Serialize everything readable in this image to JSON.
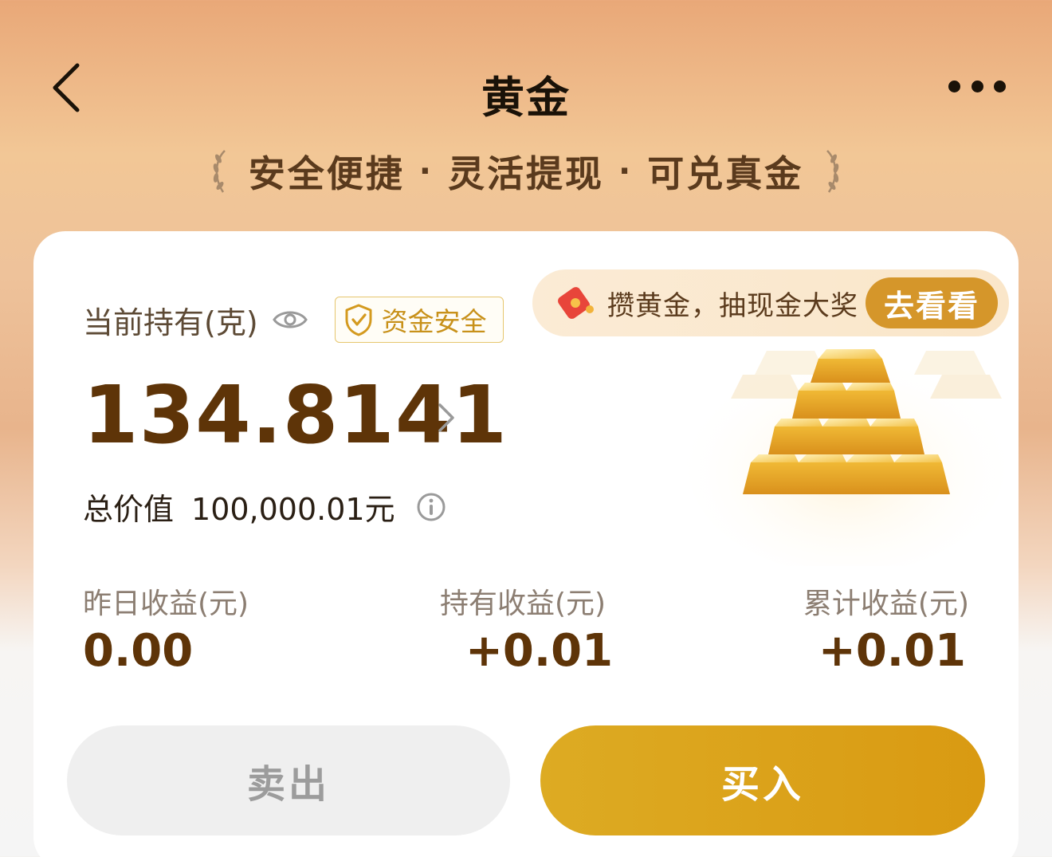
{
  "header": {
    "title": "黄金"
  },
  "slogan": {
    "items": [
      "安全便捷",
      "灵活提现",
      "可兑真金"
    ],
    "separator": "·"
  },
  "holding": {
    "label": "当前持有(克)",
    "safety_badge": "资金安全",
    "grams": "134.8141",
    "total_label": "总价值",
    "total_value": "100,000.01元"
  },
  "promo": {
    "text": "攒黄金，抽现金大奖",
    "button": "去看看"
  },
  "stats": [
    {
      "label": "昨日收益(元)",
      "value": "0.00"
    },
    {
      "label": "持有收益(元)",
      "value": "+0.01"
    },
    {
      "label": "累计收益(元)",
      "value": "+0.01"
    }
  ],
  "actions": {
    "sell": "卖出",
    "buy": "买入"
  },
  "colors": {
    "accent_gold": "#d99a12",
    "value_brown": "#5e3408"
  },
  "icons": [
    "back-arrow-icon",
    "more-icon",
    "laurel-icon",
    "eye-icon",
    "shield-check-icon",
    "red-envelope-icon",
    "chevron-right-icon",
    "info-icon",
    "gold-bars-icon"
  ]
}
